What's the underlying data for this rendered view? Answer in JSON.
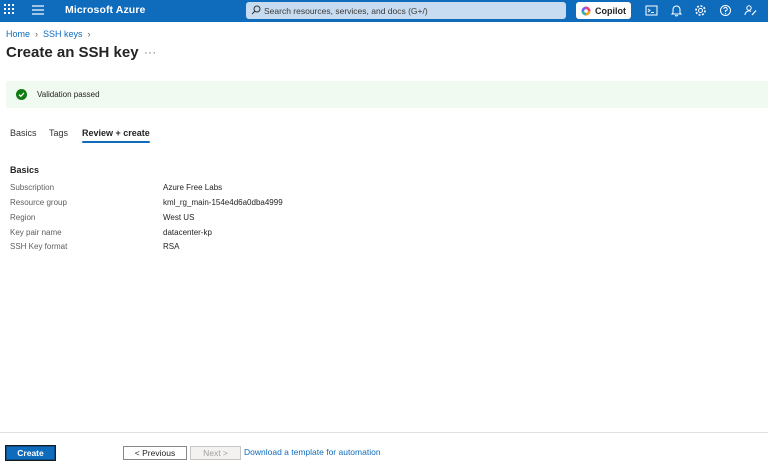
{
  "topbar": {
    "brand": "Microsoft Azure",
    "search_placeholder": "Search resources, services, and docs (G+/)",
    "copilot_label": "Copilot",
    "accent": "#0f6cbd"
  },
  "breadcrumb": [
    "Home",
    "SSH keys"
  ],
  "page": {
    "title": "Create an SSH key",
    "more": "···"
  },
  "banner": {
    "text": "Validation passed",
    "status_color": "#107c10"
  },
  "tabs": [
    {
      "label": "Basics",
      "active": false
    },
    {
      "label": "Tags",
      "active": false
    },
    {
      "label": "Review + create",
      "active": true
    }
  ],
  "summary": {
    "section_title": "Basics",
    "rows": [
      {
        "key": "Subscription",
        "value": "Azure Free Labs"
      },
      {
        "key": "Resource group",
        "value": "kml_rg_main-154e4d6a0dba4999"
      },
      {
        "key": "Region",
        "value": "West US"
      },
      {
        "key": "Key pair name",
        "value": "datacenter-kp"
      },
      {
        "key": "SSH Key format",
        "value": "RSA"
      }
    ]
  },
  "footer": {
    "create_label": "Create",
    "previous_label": "< Previous",
    "next_label": "Next >",
    "automation_link": "Download a template for automation"
  }
}
